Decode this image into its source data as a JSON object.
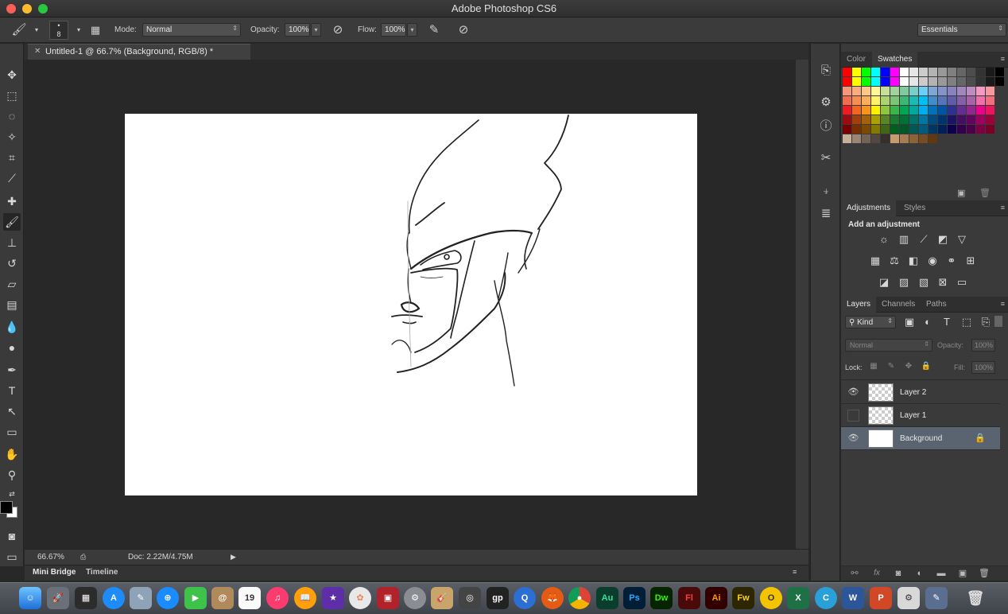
{
  "window": {
    "title": "Adobe Photoshop CS6"
  },
  "options": {
    "brush_size": "8",
    "mode_label": "Mode:",
    "mode_value": "Normal",
    "opacity_label": "Opacity:",
    "opacity_value": "100%",
    "flow_label": "Flow:",
    "flow_value": "100%",
    "workspace": "Essentials"
  },
  "document": {
    "tab_title": "Untitled-1 @ 66.7% (Background, RGB/8) *",
    "zoom": "66.67%",
    "doc_size": "Doc: 2.22M/4.75M"
  },
  "bottom_tabs": [
    "Mini Bridge",
    "Timeline"
  ],
  "color_panel": {
    "tabs": [
      "Color",
      "Swatches"
    ],
    "active": "Swatches"
  },
  "adjust_panel": {
    "tabs": [
      "Adjustments",
      "Styles"
    ],
    "heading": "Add an adjustment"
  },
  "layers_panel": {
    "tabs": [
      "Layers",
      "Channels",
      "Paths"
    ],
    "filter_kind": "Kind",
    "blend_mode": "Normal",
    "opacity_label": "Opacity:",
    "opacity_value": "100%",
    "lock_label": "Lock:",
    "fill_label": "Fill:",
    "fill_value": "100%",
    "layers": [
      {
        "name": "Layer 2",
        "visible": true
      },
      {
        "name": "Layer 1",
        "visible": false
      },
      {
        "name": "Background",
        "visible": true,
        "locked": true,
        "selected": true
      }
    ]
  },
  "colors": {
    "foreground": "#000000",
    "background": "#ffffff",
    "selected_layer": "#5a6470"
  },
  "dock": {
    "calendar_day": "19",
    "apps": [
      "Au",
      "Ps",
      "Dw",
      "Fl",
      "Ai",
      "Fw"
    ]
  }
}
